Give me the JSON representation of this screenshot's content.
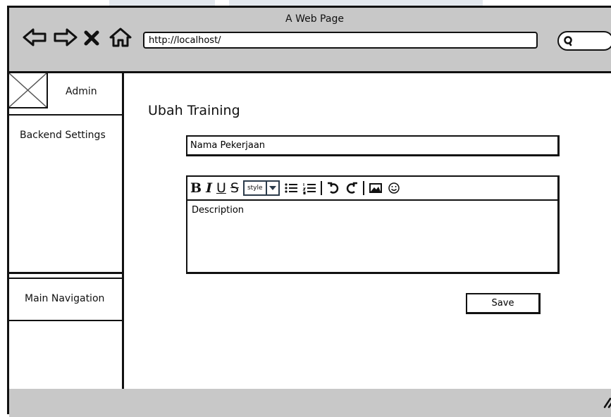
{
  "window": {
    "title": "A Web Page"
  },
  "browser": {
    "url": "http://localhost/",
    "nav": [
      "back-icon",
      "forward-icon",
      "stop-icon",
      "home-icon"
    ]
  },
  "sidebar": {
    "admin_label": "Admin",
    "sections": [
      "Backend Settings",
      "Main Navigation"
    ]
  },
  "form": {
    "title": "Ubah Training",
    "nama_value": "Nama Pekerjaan",
    "description_value": "Description",
    "toolbar": {
      "bold": "B",
      "italic": "I",
      "underline": "U",
      "strike": "S",
      "style_value": "style",
      "icons": [
        "bullet-list-icon",
        "numbered-list-icon",
        "undo-icon",
        "redo-icon",
        "image-icon",
        "emoji-icon"
      ]
    },
    "save_label": "Save"
  },
  "colors": {
    "chrome": "#c8c8c8",
    "border": "#111111",
    "style_select_border": "#2b3b4b"
  }
}
